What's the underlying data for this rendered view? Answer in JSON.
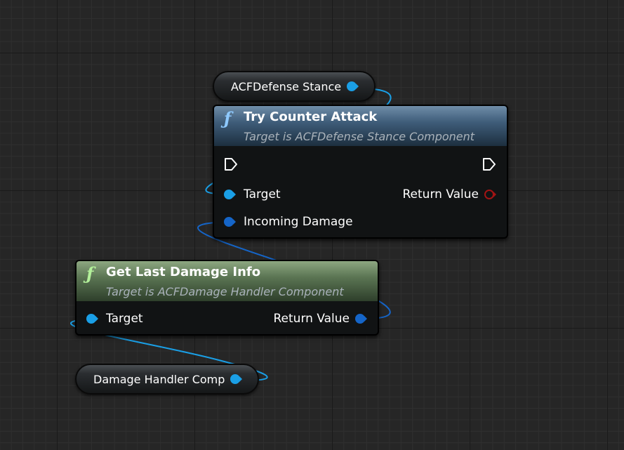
{
  "nodes": {
    "defense_stance_var": {
      "label": "ACFDefense Stance"
    },
    "try_counter_attack": {
      "icon": "function-icon",
      "title": "Try Counter Attack",
      "subtitle": "Target is ACFDefense Stance Component",
      "pins": {
        "target": "Target",
        "incoming_damage": "Incoming Damage",
        "return_value": "Return Value"
      }
    },
    "get_last_damage_info": {
      "icon": "function-icon",
      "title": "Get Last Damage Info",
      "subtitle": "Target is ACFDamage Handler Component",
      "pins": {
        "target": "Target",
        "return_value": "Return Value"
      }
    },
    "damage_handler_var": {
      "label": "Damage Handler Comp"
    }
  },
  "colors": {
    "object_pin": "#1a9fe6",
    "struct_pin": "#1565c8",
    "bool_pin": "#a21414",
    "function_header_blue": "#3f5d7a",
    "function_header_green": "#5b7553",
    "grid_background": "#262626"
  }
}
